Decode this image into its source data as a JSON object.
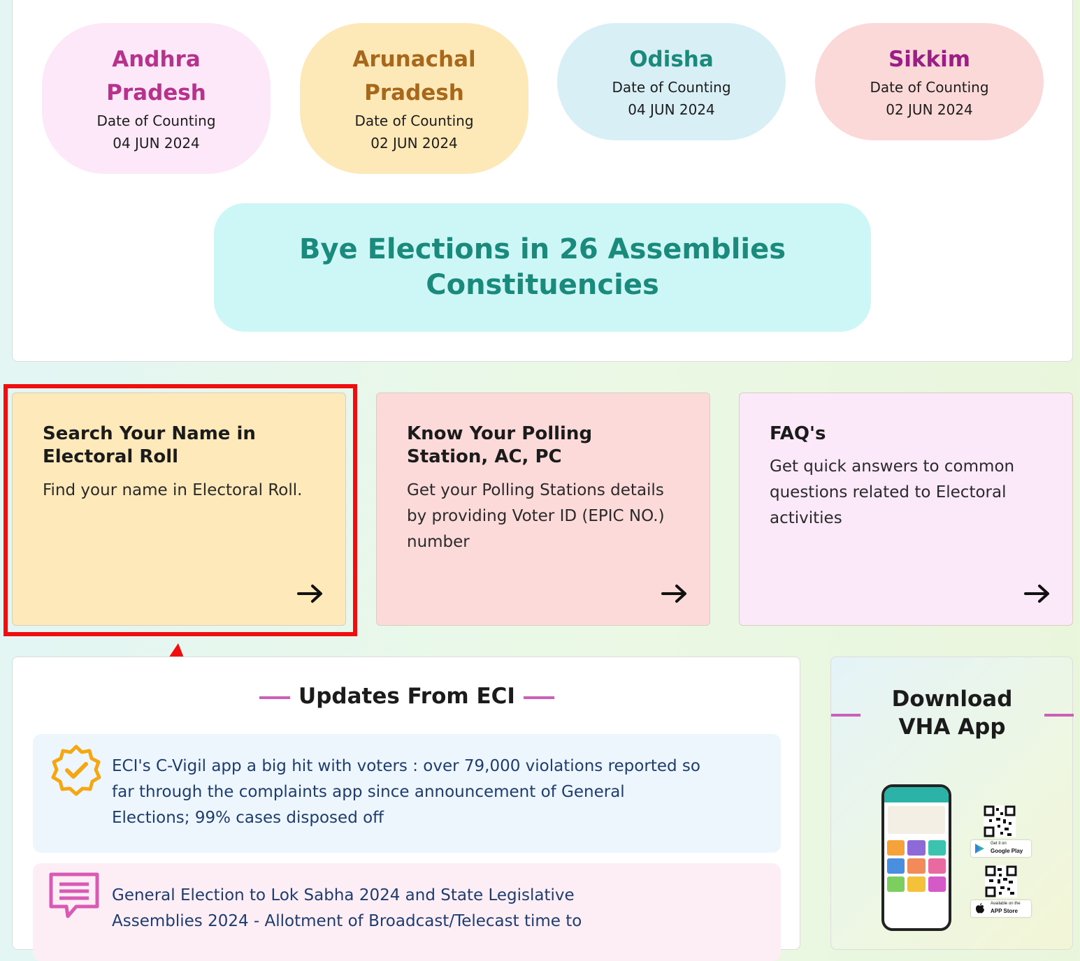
{
  "states": [
    {
      "name": "Andhra Pradesh",
      "label": "Date of Counting",
      "date": "04 JUN 2024",
      "bg": "#fce8f8",
      "color": "#b7328c"
    },
    {
      "name": "Arunachal Pradesh",
      "label": "Date of Counting",
      "date": "02 JUN 2024",
      "bg": "#fde8b8",
      "color": "#a8681c"
    },
    {
      "name": "Odisha",
      "label": "Date of Counting",
      "date": "04 JUN 2024",
      "bg": "#d9eff6",
      "color": "#1a8a7c"
    },
    {
      "name": "Sikkim",
      "label": "Date of Counting",
      "date": "02 JUN 2024",
      "bg": "#fcd9d9",
      "color": "#9b1d86"
    }
  ],
  "bye_elections": {
    "title": "Bye Elections in 26 Assemblies Constituencies"
  },
  "cards": [
    {
      "title": "Search Your Name in Electoral Roll",
      "desc": "Find your name in Electoral Roll.",
      "bg": "#fde9b9"
    },
    {
      "title": "Know Your Polling Station, AC, PC",
      "desc": "Get your Polling Stations details by providing Voter ID (EPIC NO.) number",
      "bg": "#fddada"
    },
    {
      "title": "FAQ's",
      "desc": "Get quick answers to common questions related to Electoral activities",
      "bg": "#fbe9fa"
    }
  ],
  "updates": {
    "heading": "Updates From ECI",
    "items": [
      {
        "text": "ECI's C-Vigil app a big hit with voters : over 79,000 violations reported so far through the complaints app since announcement of General Elections; 99% cases disposed off",
        "icon": "verified-badge-icon",
        "bg": "#eef6fd"
      },
      {
        "text": "General Election to Lok Sabha 2024 and State Legislative Assemblies 2024 - Allotment of Broadcast/Telecast time to",
        "icon": "message-icon",
        "bg": "#fdeef6"
      }
    ]
  },
  "app": {
    "title": "Download VHA App",
    "google_small": "Get it on",
    "google_big": "Google Play",
    "apple_small": "Available on the",
    "apple_big": "APP Store"
  },
  "colors": {
    "accent_dash": "#cc5fb7",
    "highlight": "#f00e0e",
    "arrow": "#f00e0e"
  }
}
